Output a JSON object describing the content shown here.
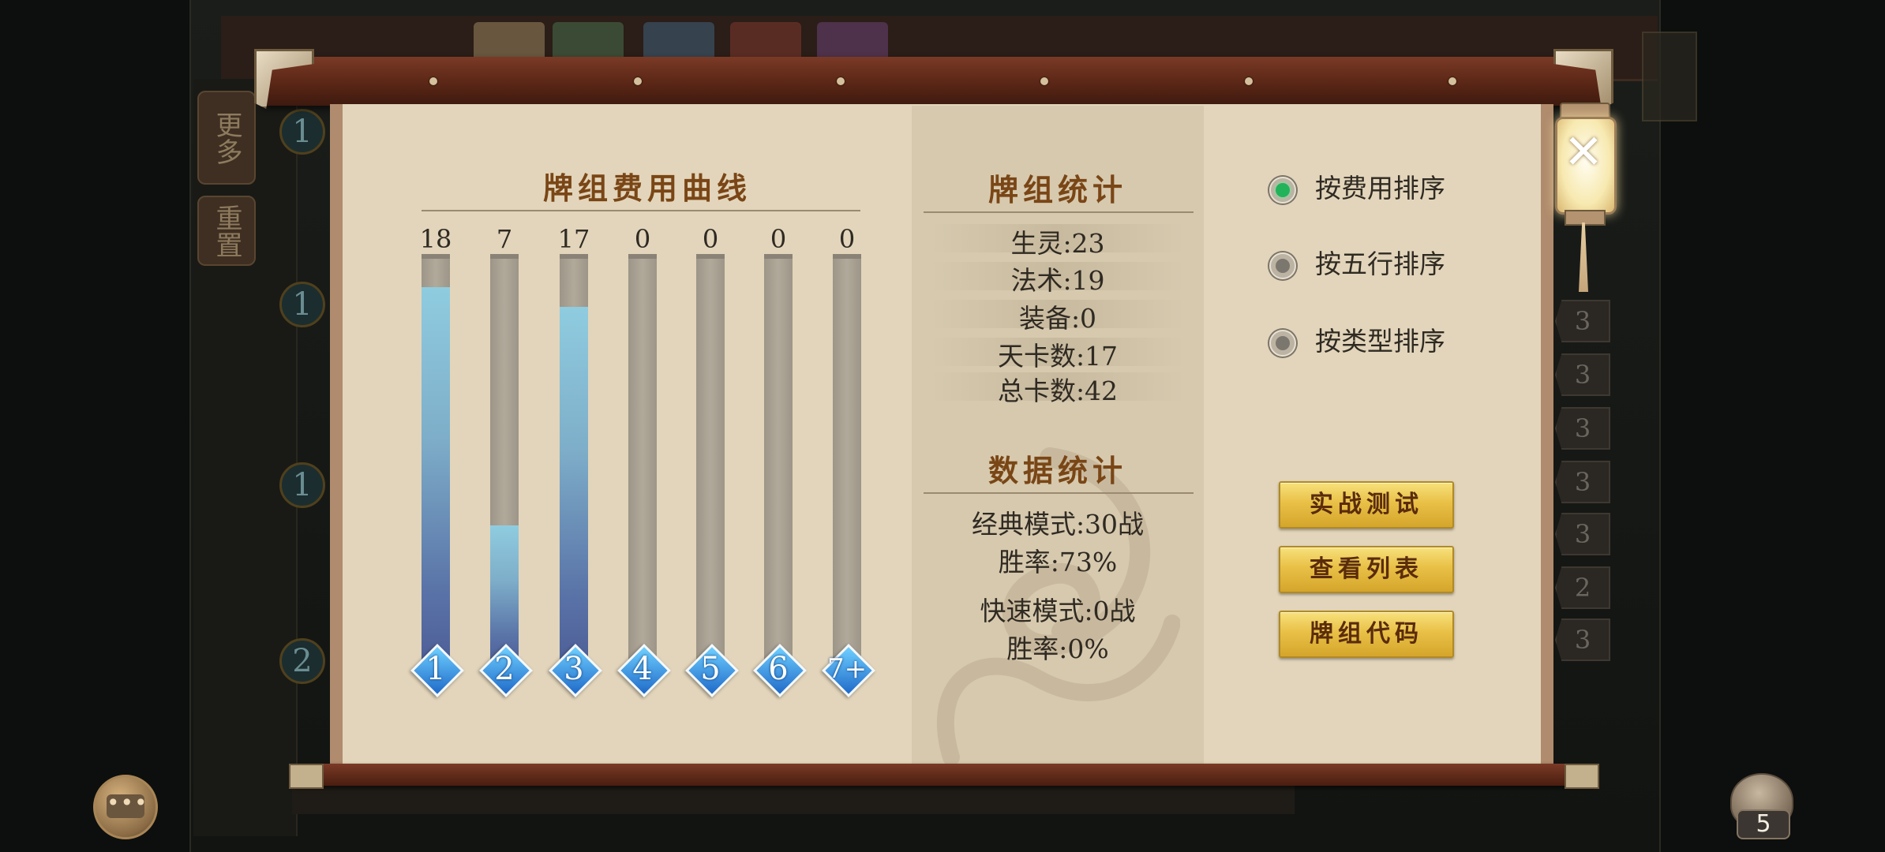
{
  "cost_curve": {
    "title": "牌组费用曲线",
    "bars": [
      {
        "cost": "1",
        "count": "18",
        "fill": 0.93
      },
      {
        "cost": "2",
        "count": "7",
        "fill": 0.34
      },
      {
        "cost": "3",
        "count": "17",
        "fill": 0.88
      },
      {
        "cost": "4",
        "count": "0",
        "fill": 0
      },
      {
        "cost": "5",
        "count": "0",
        "fill": 0
      },
      {
        "cost": "6",
        "count": "0",
        "fill": 0
      },
      {
        "cost": "7+",
        "count": "0",
        "fill": 0
      }
    ],
    "bar_color": "#7eaec9",
    "gem_color": "#1f6ac9"
  },
  "deck_stats": {
    "title": "牌组统计",
    "lines": [
      "生灵:23",
      "法术:19",
      "装备:0",
      "天卡数:17",
      "总卡数:42"
    ]
  },
  "data_stats": {
    "title": "数据统计",
    "lines": [
      "经典模式:30战",
      "胜率:73%",
      "快速模式:0战",
      "胜率:0%"
    ]
  },
  "sort_options": [
    {
      "label": "按费用排序",
      "selected": true
    },
    {
      "label": "按五行排序",
      "selected": false
    },
    {
      "label": "按类型排序",
      "selected": false
    }
  ],
  "buttons": {
    "practice": "实战测试",
    "view_list": "查看列表",
    "deck_code": "牌组代码"
  },
  "close_icon": "close-x-icon",
  "bottom": {
    "chat_icon": "chat-icon",
    "pouch_count": "5"
  },
  "background": {
    "left_buttons": [
      "更多",
      "重置"
    ],
    "cost_chips": [
      "1",
      "1",
      "1",
      "2"
    ],
    "count_chips": [
      "3",
      "3",
      "3",
      "3",
      "3",
      "2",
      "3"
    ]
  },
  "colors": {
    "radio_active": "#22b35a",
    "title": "#7a4616",
    "button_gold": "#e9c046"
  }
}
